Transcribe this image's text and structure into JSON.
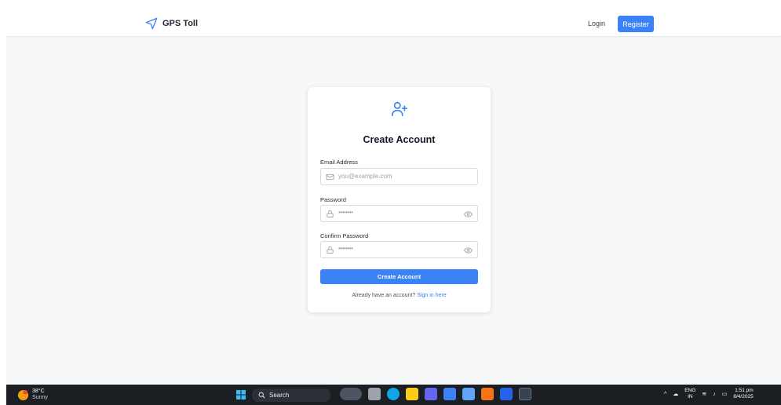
{
  "navbar": {
    "brand": "GPS Toll",
    "login_label": "Login",
    "register_label": "Register"
  },
  "form": {
    "title": "Create Account",
    "email_label": "Email Address",
    "email_placeholder": "you@example.com",
    "password_label": "Password",
    "password_value": "••••••••",
    "confirm_label": "Confirm Password",
    "confirm_value": "••••••••",
    "submit_label": "Create Account",
    "signin_prompt": "Already have an account?",
    "signin_link": "Sign in here"
  },
  "colors": {
    "accent": "#3b82f6"
  },
  "taskbar": {
    "weather_temp": "38°C",
    "weather_cond": "Sunny",
    "search_label": "Search",
    "lang_line1": "ENG",
    "lang_line2": "IN",
    "time": "1:51 pm",
    "date": "8/4/2025"
  }
}
